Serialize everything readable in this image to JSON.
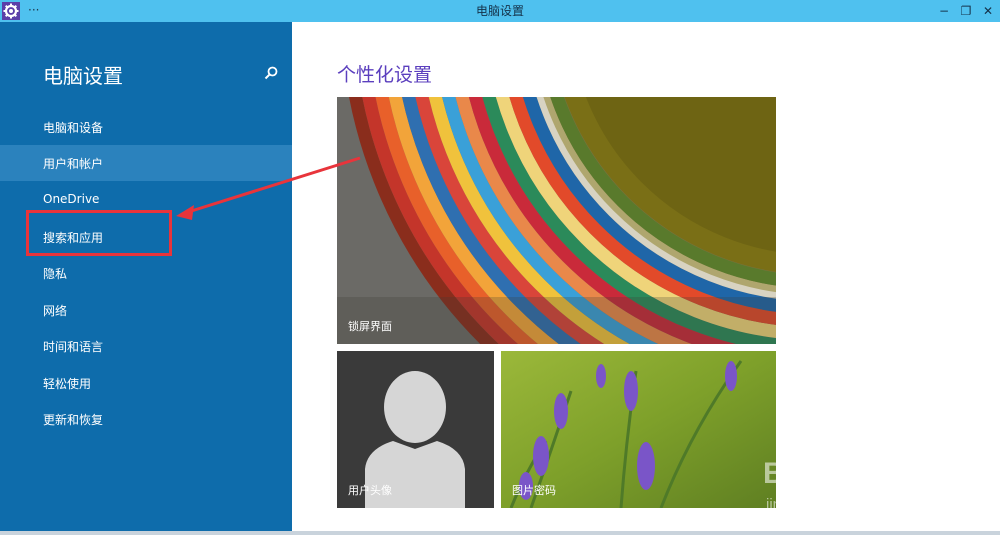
{
  "window": {
    "title": "电脑设置",
    "menu": "···"
  },
  "window_controls": {
    "minimize": "−",
    "restore": "❐",
    "close": "✕"
  },
  "sidebar": {
    "title": "电脑设置",
    "search_icon": "search-icon",
    "items": [
      {
        "label": "电脑和设备"
      },
      {
        "label": "用户和帐户",
        "selected": true
      },
      {
        "label": "OneDrive"
      },
      {
        "label": "搜索和应用"
      },
      {
        "label": "隐私"
      },
      {
        "label": "网络"
      },
      {
        "label": "时间和语言"
      },
      {
        "label": "轻松使用"
      },
      {
        "label": "更新和恢复"
      }
    ]
  },
  "main": {
    "heading": "个性化设置",
    "tiles": {
      "lock_screen": "锁屏界面",
      "avatar": "用户头像",
      "picture_password": "图片密码"
    }
  },
  "watermark": {
    "brand": "Baidu经验",
    "url": "jingyan.baidu.com"
  },
  "colors": {
    "titlebar": "#4fc1ef",
    "sidebar": "#0e6cab",
    "sidebar_selected": "#2b82bd",
    "heading": "#5b3fbe",
    "annotation": "#e8343b"
  }
}
